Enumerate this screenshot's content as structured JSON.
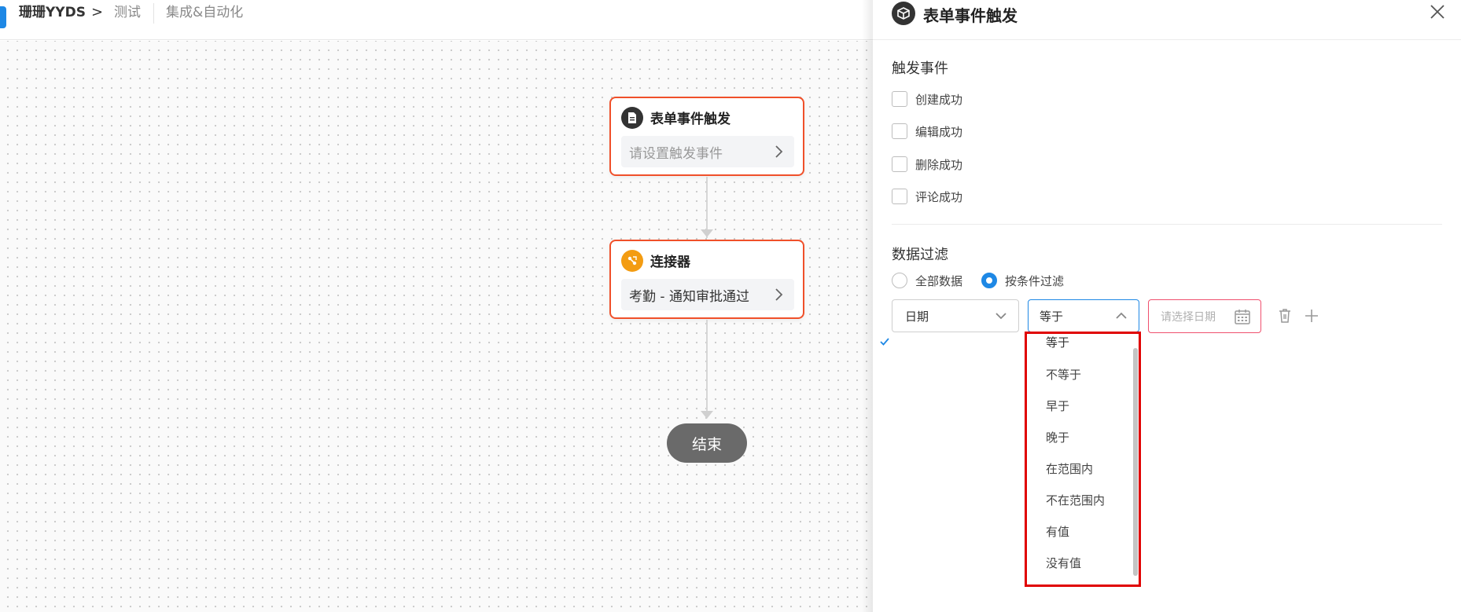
{
  "breadcrumb": {
    "app_name": "珊珊YYDS",
    "separator": ">",
    "test": "测试",
    "integration": "集成&自动化"
  },
  "canvas": {
    "trigger_node": {
      "title": "表单事件触发",
      "body": "请设置触发事件",
      "icon": "document-icon"
    },
    "connector_node": {
      "title": "连接器",
      "body": "考勤 - 通知审批通过",
      "icon": "connector-icon"
    },
    "end_label": "结束"
  },
  "panel": {
    "title": "表单事件触发",
    "icon": "cube-icon",
    "trigger_section": {
      "title": "触发事件",
      "options": [
        "创建成功",
        "编辑成功",
        "删除成功",
        "评论成功"
      ]
    },
    "filter_section": {
      "title": "数据过滤",
      "radio_all": "全部数据",
      "radio_condition": "按条件过滤",
      "selected_radio": "按条件过滤",
      "field_value": "日期",
      "operator_value": "等于",
      "date_placeholder": "请选择日期"
    },
    "operator_options": [
      "等于",
      "不等于",
      "早于",
      "晚于",
      "在范围内",
      "不在范围内",
      "有值",
      "没有值"
    ]
  },
  "colors": {
    "accent": "#1e88e5",
    "node_border": "#f0502a",
    "highlight_box": "#e00000",
    "error_border": "#f0506e",
    "end_pill": "#6a6a6a"
  }
}
